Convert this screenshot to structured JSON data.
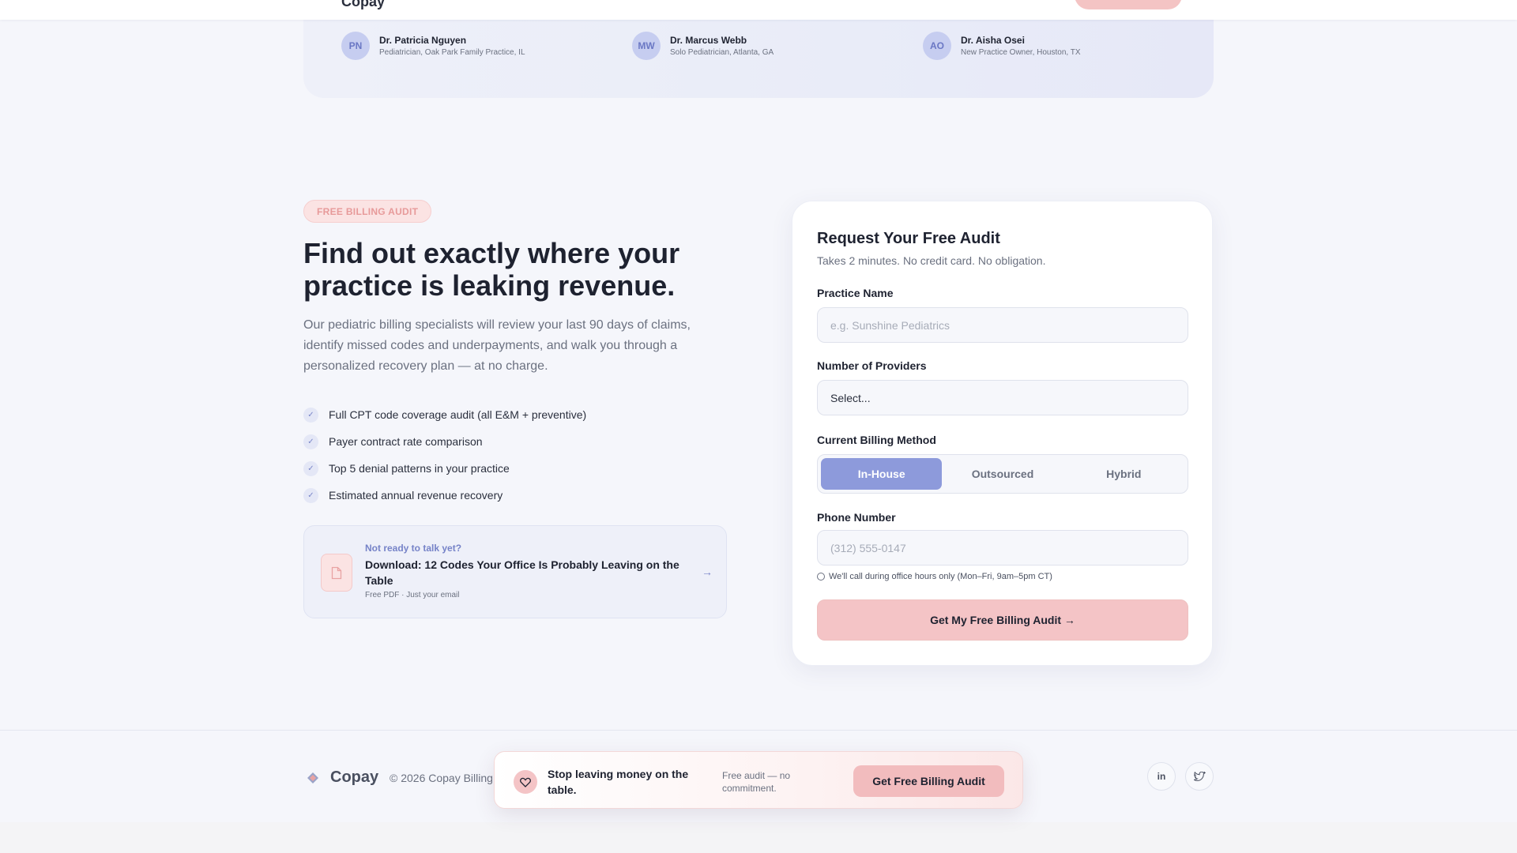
{
  "nav": {
    "logo_fragment": "Copay"
  },
  "testimonials": [
    {
      "initials": "PN",
      "name": "Dr. Patricia Nguyen",
      "role": "Pediatrician, Oak Park Family Practice, IL"
    },
    {
      "initials": "MW",
      "name": "Dr. Marcus Webb",
      "role": "Solo Pediatrician, Atlanta, GA"
    },
    {
      "initials": "AO",
      "name": "Dr. Aisha Osei",
      "role": "New Practice Owner, Houston, TX"
    }
  ],
  "audit": {
    "badge": "FREE BILLING AUDIT",
    "headline": "Find out exactly where your practice is leaking revenue.",
    "lead": "Our pediatric billing specialists will review your last 90 days of claims, identify missed codes and underpayments, and walk you through a personalized recovery plan — at no charge.",
    "checklist": [
      "Full CPT code coverage audit (all E&M + preventive)",
      "Payer contract rate comparison",
      "Top 5 denial patterns in your practice",
      "Estimated annual revenue recovery"
    ],
    "download": {
      "kicker": "Not ready to talk yet?",
      "title": "Download: 12 Codes Your Office Is Probably Leaving on the Table",
      "meta": "Free PDF · Just your email"
    }
  },
  "form": {
    "title": "Request Your Free Audit",
    "subtitle": "Takes 2 minutes. No credit card. No obligation.",
    "practice_label": "Practice Name",
    "practice_placeholder": "e.g. Sunshine Pediatrics",
    "providers_label": "Number of Providers",
    "providers_value": "Select...",
    "method_label": "Current Billing Method",
    "methods": [
      "In-House",
      "Outsourced",
      "Hybrid"
    ],
    "phone_label": "Phone Number",
    "phone_placeholder": "(312) 555-0147",
    "hint": "We'll call during office hours only (Mon–Fri, 9am–5pm CT)",
    "submit": "Get My Free Billing Audit →"
  },
  "footer": {
    "brand": "Copay",
    "copyright": "© 2026 Copay Billing",
    "social": [
      "in",
      "twitter"
    ]
  },
  "cta_bar": {
    "message": "Stop leaving money on the table.",
    "sub": "Free audit — no commitment.",
    "button": "Get Free Billing Audit"
  },
  "colors": {
    "accent_pink": "#f4c4c6",
    "accent_periwinkle": "#8d9adb"
  }
}
